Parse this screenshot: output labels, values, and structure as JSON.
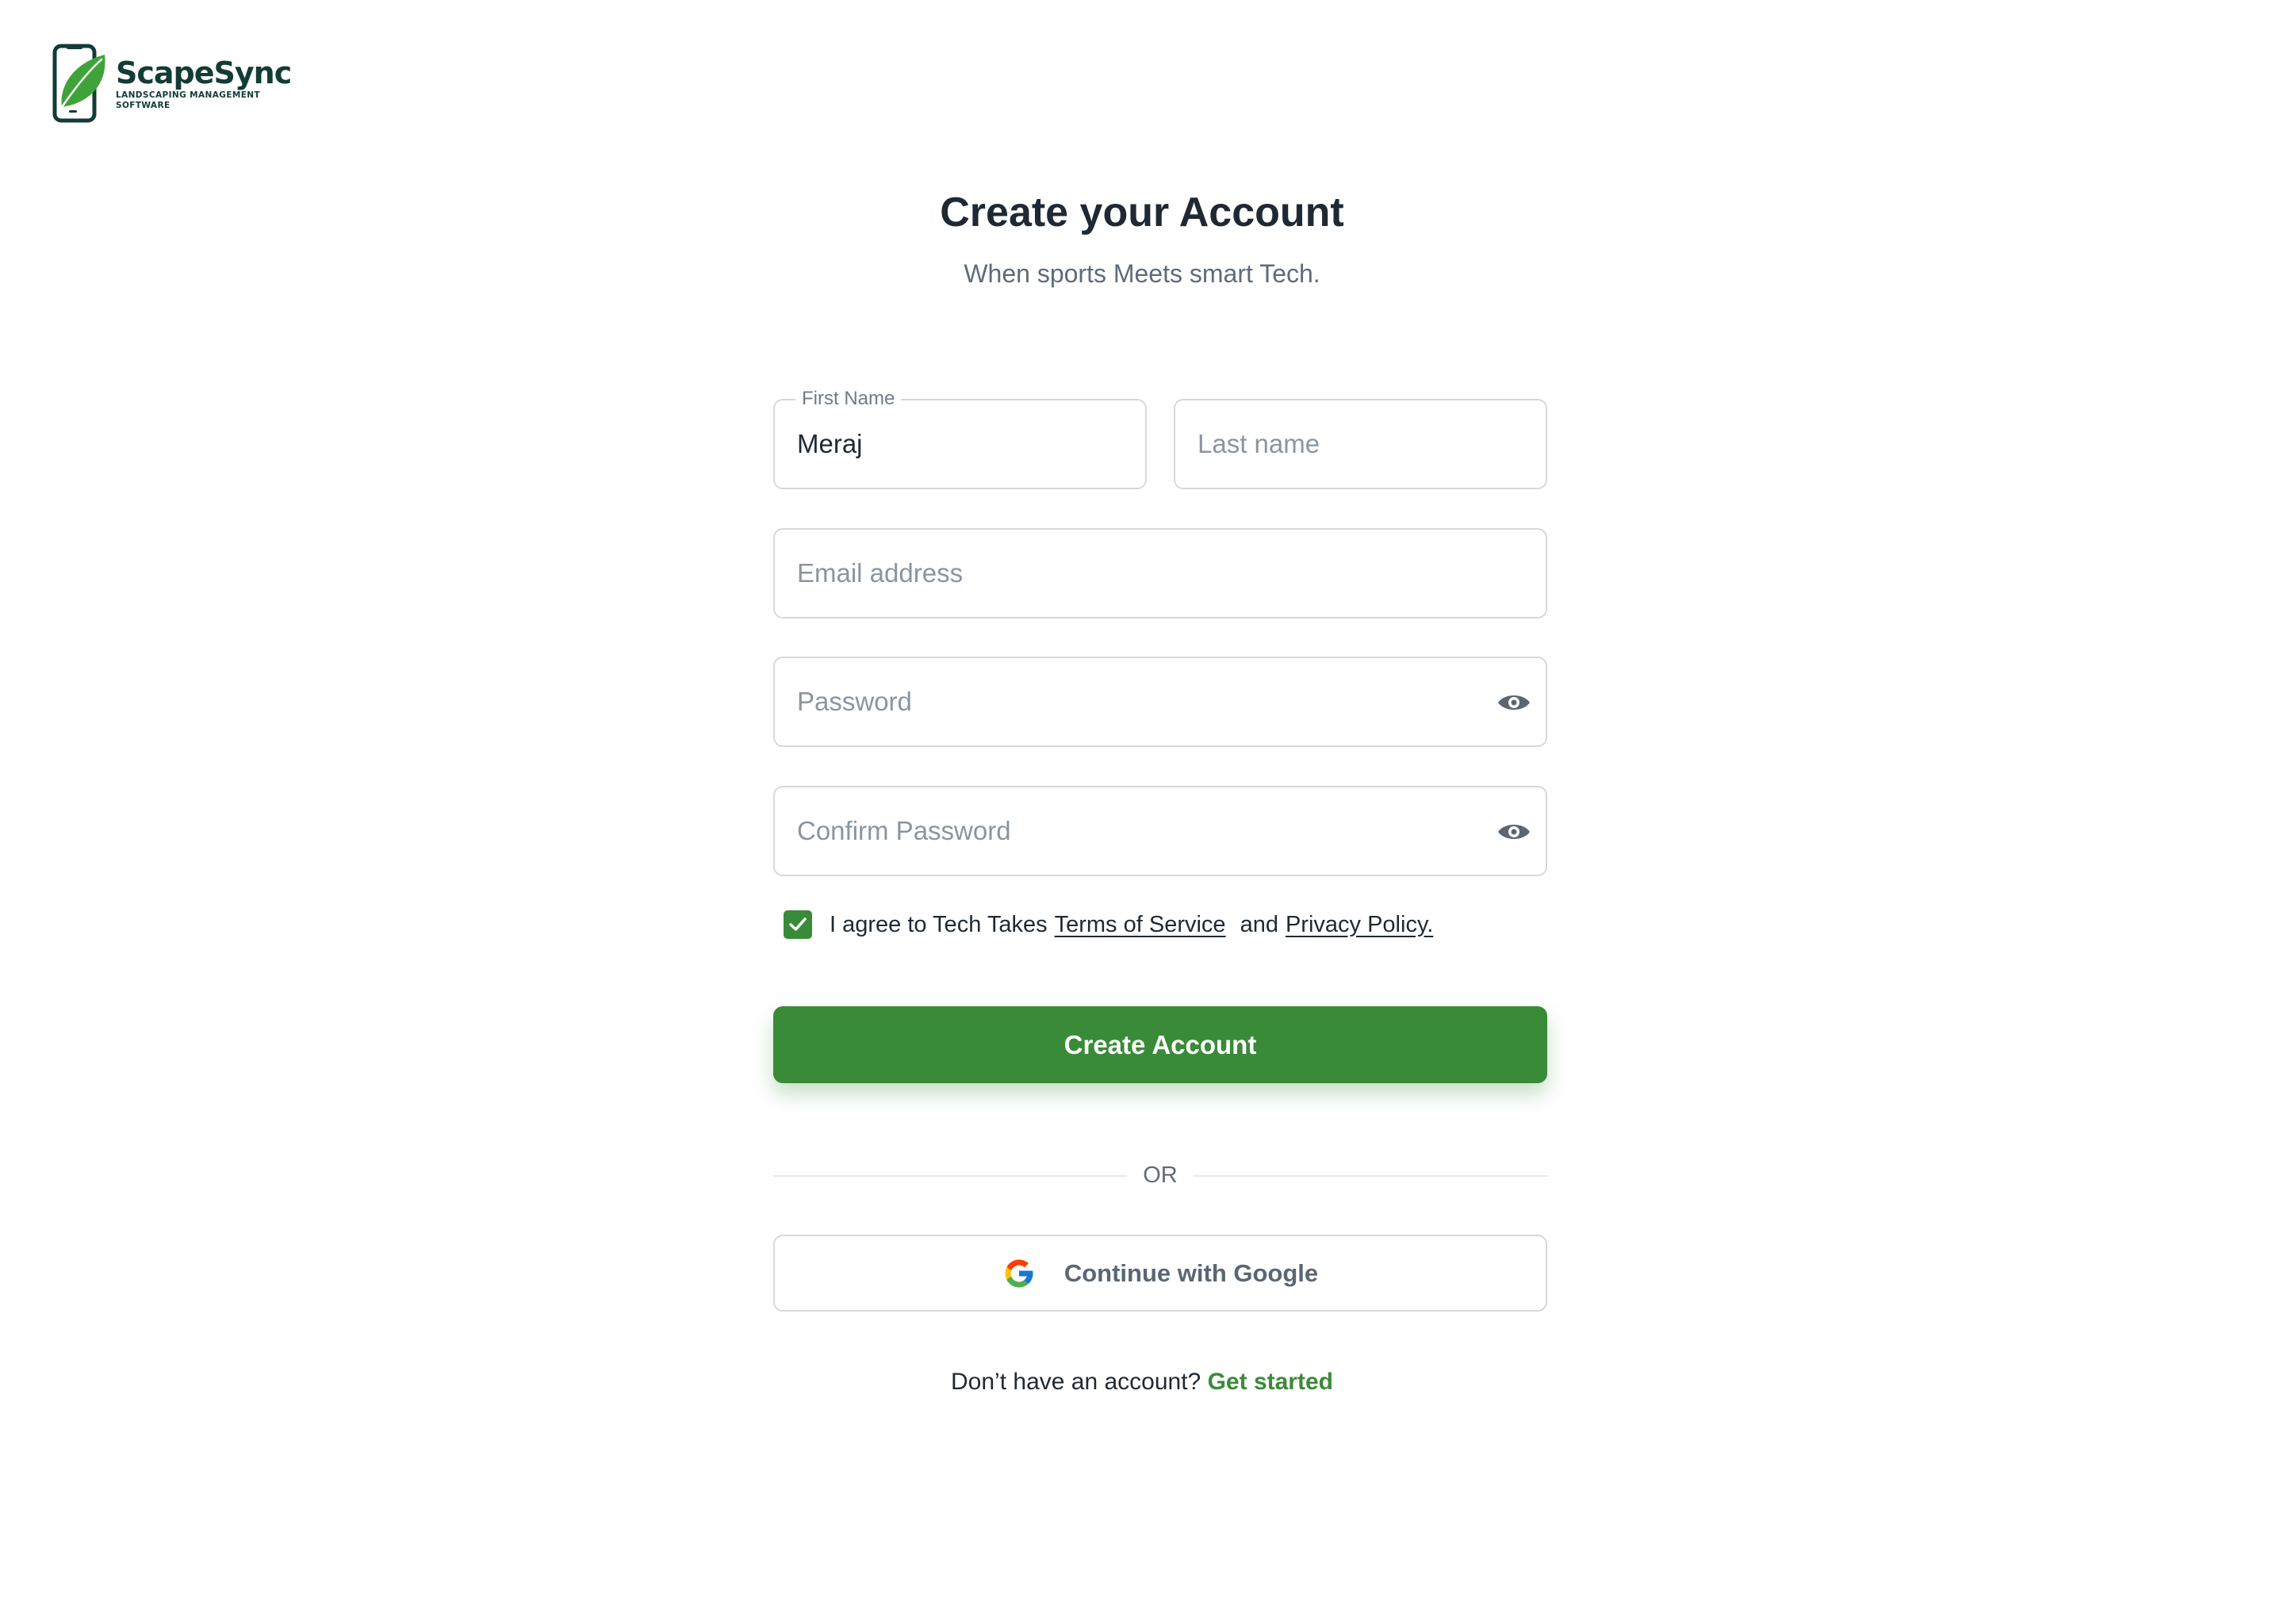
{
  "brand": {
    "name": "ScapeSync",
    "tagline": "LANDSCAPING MANAGEMENT SOFTWARE",
    "logo_icon": "phone-leaf-icon",
    "colors": {
      "primary": "#3a8b38",
      "dark": "#123c35",
      "leaf": "#3fa33a"
    }
  },
  "header": {
    "title": "Create your Account",
    "subtitle": "When sports Meets smart Tech."
  },
  "form": {
    "first_name": {
      "label": "First Name",
      "value": "Meraj"
    },
    "last_name": {
      "placeholder": "Last name",
      "value": ""
    },
    "email": {
      "placeholder": "Email address",
      "value": ""
    },
    "password": {
      "placeholder": "Password",
      "value": "",
      "toggle_icon": "eye-icon"
    },
    "confirm_password": {
      "placeholder": "Confirm Password",
      "value": "",
      "toggle_icon": "eye-icon"
    },
    "terms": {
      "checked": true,
      "prefix": "I agree to Tech Takes",
      "terms_link": "Terms of Service",
      "middle": "and",
      "privacy_link": "Privacy Policy."
    },
    "submit_label": "Create Account"
  },
  "divider": {
    "label": "OR"
  },
  "google": {
    "label": "Continue with Google",
    "icon": "google-icon"
  },
  "footer": {
    "prompt": "Don’t have an account?",
    "link": "Get started"
  }
}
